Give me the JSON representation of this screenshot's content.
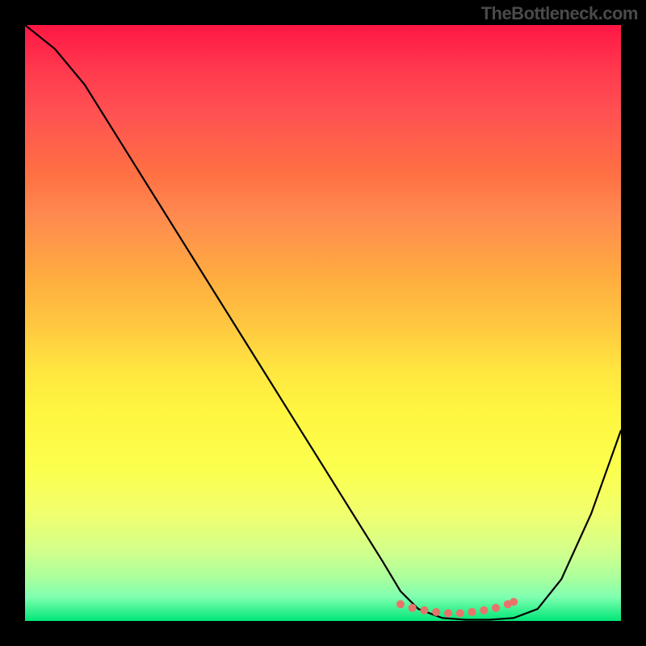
{
  "watermark": "TheBottleneck.com",
  "chart_data": {
    "type": "line",
    "title": "",
    "xlabel": "",
    "ylabel": "",
    "xlim": [
      0,
      100
    ],
    "ylim": [
      0,
      100
    ],
    "curve": {
      "x": [
        0,
        5,
        10,
        15,
        20,
        25,
        30,
        35,
        40,
        45,
        50,
        55,
        60,
        63,
        66,
        70,
        74,
        78,
        82,
        86,
        90,
        95,
        100
      ],
      "y": [
        100,
        96,
        90,
        82,
        74,
        66,
        58,
        50,
        42,
        34,
        26,
        18,
        10,
        5,
        2,
        0.5,
        0.2,
        0.2,
        0.5,
        2,
        7,
        18,
        32
      ]
    },
    "markers": {
      "x": [
        63,
        65,
        67,
        69,
        71,
        73,
        75,
        77,
        79,
        81,
        82
      ],
      "y": [
        2.8,
        2.2,
        1.8,
        1.5,
        1.3,
        1.3,
        1.5,
        1.8,
        2.2,
        2.8,
        3.2
      ],
      "color": "#e8736b",
      "size": 5
    },
    "gradient_colors": {
      "top": "#ff1744",
      "middle": "#ffe640",
      "bottom": "#00e676"
    }
  }
}
